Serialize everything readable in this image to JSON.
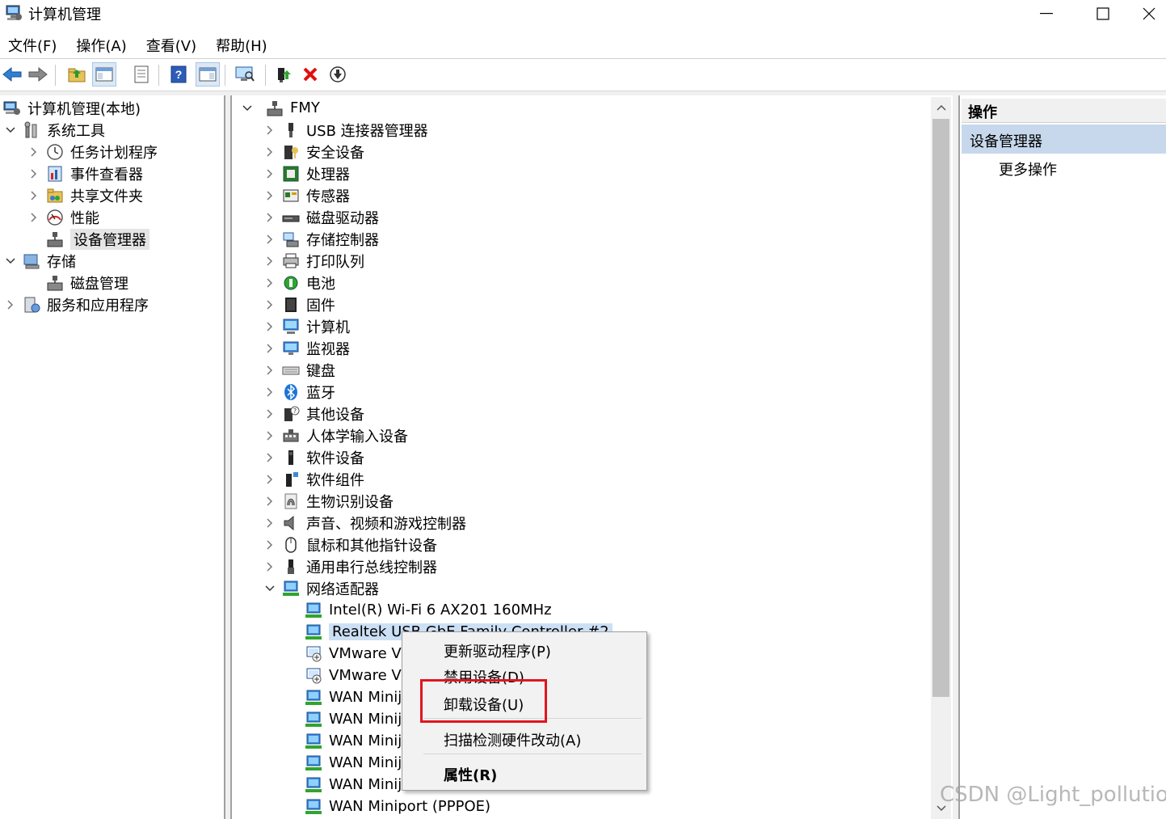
{
  "window": {
    "title": "计算机管理",
    "minimize_glyph": "—",
    "maximize_glyph": "☐",
    "close_glyph": "✕"
  },
  "menu": [
    "文件(F)",
    "操作(A)",
    "查看(V)",
    "帮助(H)"
  ],
  "left_tree": {
    "root": "计算机管理(本地)",
    "system_tools": "系统工具",
    "task_scheduler": "任务计划程序",
    "event_viewer": "事件查看器",
    "shared_folders": "共享文件夹",
    "performance": "性能",
    "device_manager": "设备管理器",
    "storage": "存储",
    "disk_management": "磁盘管理",
    "services_apps": "服务和应用程序"
  },
  "device_tree": {
    "root": "FMY",
    "categories": [
      "USB 连接器管理器",
      "安全设备",
      "处理器",
      "传感器",
      "磁盘驱动器",
      "存储控制器",
      "打印队列",
      "电池",
      "固件",
      "计算机",
      "监视器",
      "键盘",
      "蓝牙",
      "其他设备",
      "人体学输入设备",
      "软件设备",
      "软件组件",
      "生物识别设备",
      "声音、视频和游戏控制器",
      "鼠标和其他指针设备",
      "通用串行总线控制器"
    ],
    "network_adapters": "网络适配器",
    "adapters": [
      "Intel(R) Wi-Fi 6 AX201 160MHz",
      "Realtek USB GbE Family Controller #2",
      "VMware Vi",
      "VMware Vi",
      "WAN Minij",
      "WAN Minij",
      "WAN Minij",
      "WAN Minij",
      "WAN Minij",
      "WAN Miniport (PPPOE)"
    ]
  },
  "actions_pane": {
    "header": "操作",
    "section": "设备管理器",
    "more": "更多操作"
  },
  "context_menu": {
    "update_driver": "更新驱动程序(P)",
    "disable_device": "禁用设备(D)",
    "uninstall_device": "卸载设备(U)",
    "scan_hardware": "扫描检测硬件改动(A)",
    "properties": "属性(R)"
  },
  "watermark": "CSDN @Light_pollution",
  "colors": {
    "selection": "#c7d8ec",
    "highlight_border": "#e0161e",
    "accent": "#1e74d4"
  }
}
